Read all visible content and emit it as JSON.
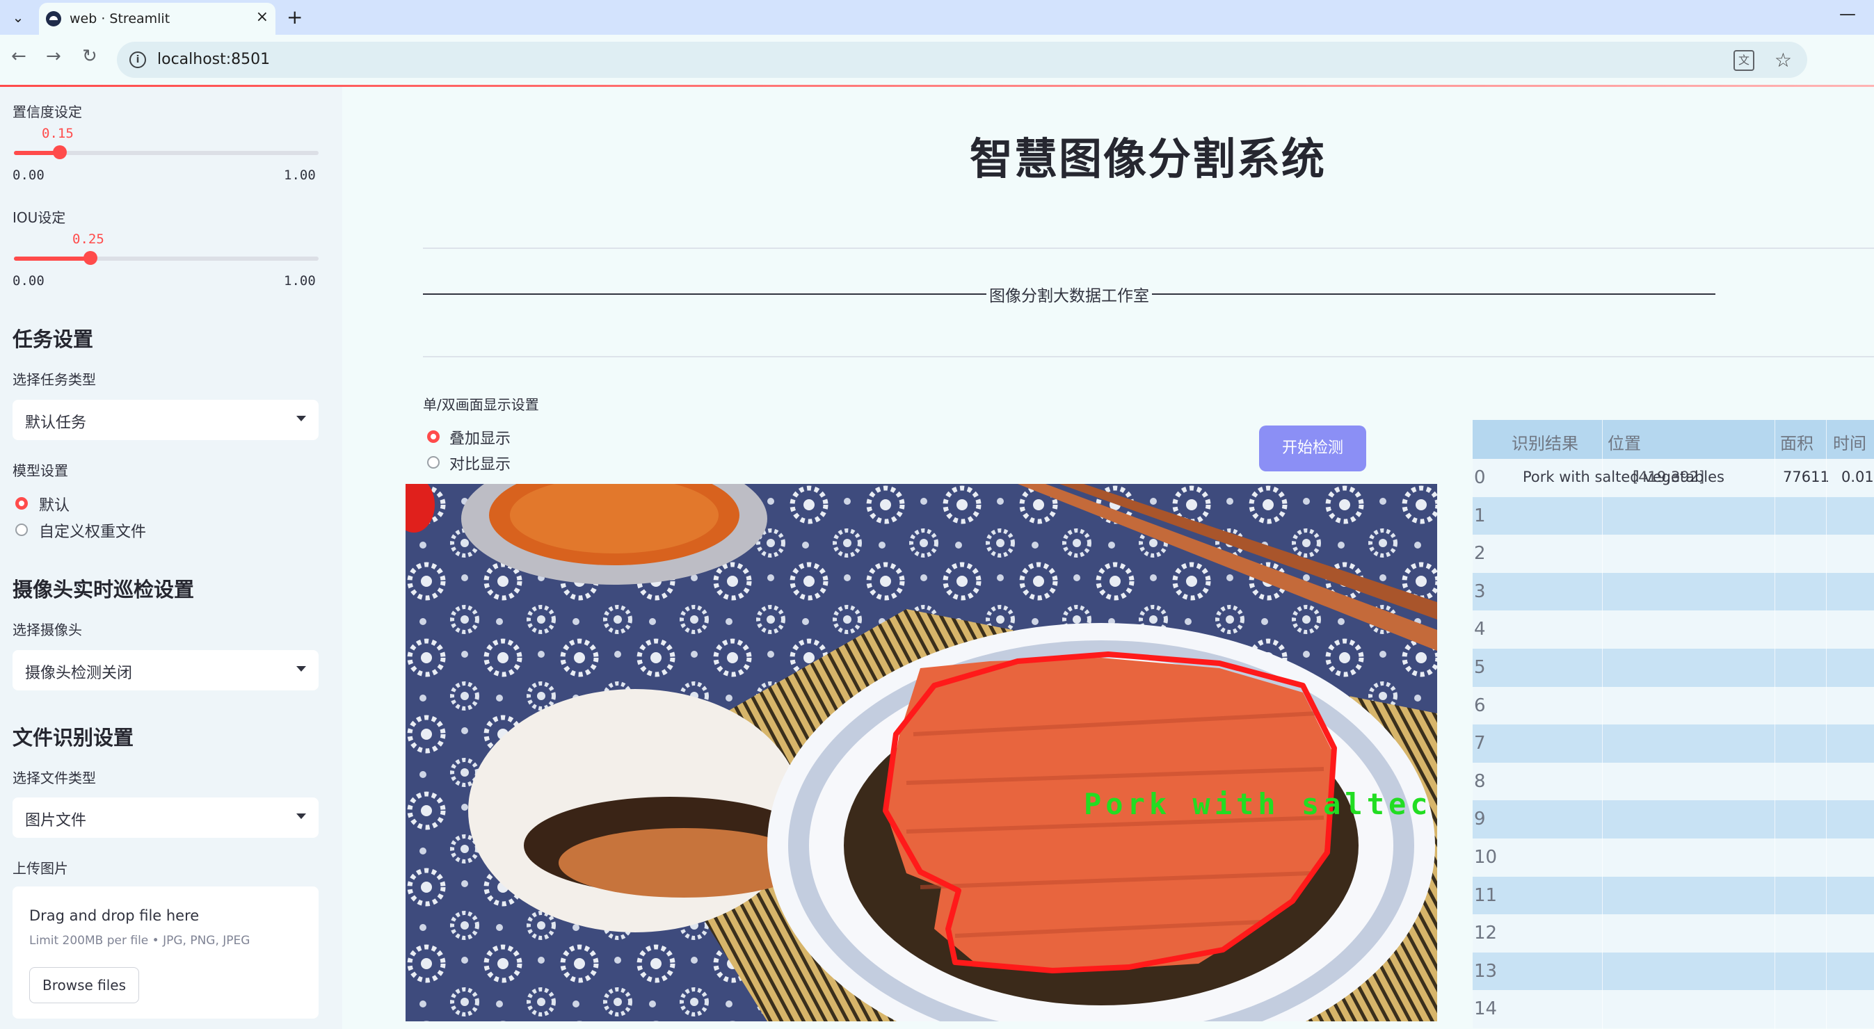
{
  "browser": {
    "tab_title": "web · Streamlit",
    "url": "localhost:8501"
  },
  "sidebar": {
    "confidence": {
      "label": "置信度设定",
      "value": "0.15",
      "min": "0.00",
      "max": "1.00",
      "fraction": 0.15
    },
    "iou": {
      "label": "IOU设定",
      "value": "0.25",
      "min": "0.00",
      "max": "1.00",
      "fraction": 0.25
    },
    "task": {
      "header": "任务设置",
      "label": "选择任务类型",
      "selected": "默认任务"
    },
    "model": {
      "label": "模型设置",
      "options": [
        "默认",
        "自定义权重文件"
      ],
      "selected_index": 0
    },
    "camera": {
      "header": "摄像头实时巡检设置",
      "label": "选择摄像头",
      "selected": "摄像头检测关闭"
    },
    "file": {
      "header": "文件识别设置",
      "label": "选择文件类型",
      "selected": "图片文件"
    },
    "upload": {
      "label": "上传图片",
      "title": "Drag and drop file here",
      "limit": "Limit 200MB per file • JPG, PNG, JPEG",
      "button": "Browse files"
    }
  },
  "main": {
    "title": "智慧图像分割系统",
    "studio": "图像分割大数据工作室",
    "display_mode": {
      "label": "单/双画面显示设置",
      "options": [
        "叠加显示",
        "对比显示"
      ],
      "selected_index": 0
    },
    "start_button": "开始检测",
    "image": {
      "detection_label": "Pork with saltec",
      "mask_color": "#ff1a1a",
      "label_color": "#22dd22"
    }
  },
  "table": {
    "columns": [
      "识别结果",
      "位置",
      "面积",
      "时间"
    ],
    "rows": [
      {
        "index": "0",
        "result": "Pork with salted vegetables",
        "position": "[419,392]",
        "area": "77611",
        "time": "0.01"
      },
      {
        "index": "1"
      },
      {
        "index": "2"
      },
      {
        "index": "3"
      },
      {
        "index": "4"
      },
      {
        "index": "5"
      },
      {
        "index": "6"
      },
      {
        "index": "7"
      },
      {
        "index": "8"
      },
      {
        "index": "9"
      },
      {
        "index": "10"
      },
      {
        "index": "11"
      },
      {
        "index": "12"
      },
      {
        "index": "13"
      },
      {
        "index": "14"
      }
    ]
  }
}
